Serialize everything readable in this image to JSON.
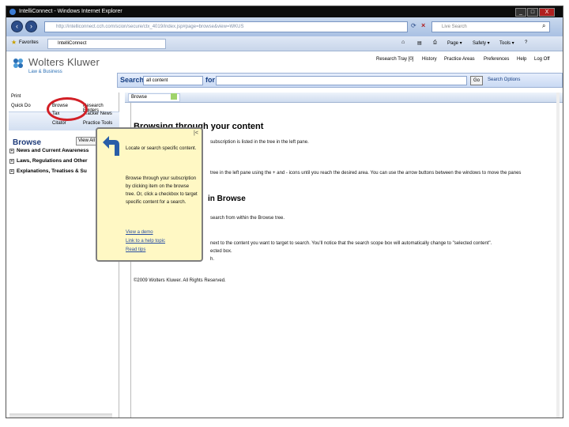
{
  "window": {
    "title": "IntelliConnect - Windows Internet Explorer",
    "controls": [
      "_",
      "□",
      "X"
    ]
  },
  "address": {
    "url": "http://intelliconnect.cch.com/scion/secure/ctx_4019/index.jsp#page=browse&view=WKUS",
    "search_placeholder": "Live Search"
  },
  "favorites": {
    "label": "Favorites",
    "tab_label": "IntelliConnect"
  },
  "command_bar": {
    "page": "Page ▾",
    "safety": "Safety ▾",
    "tools": "Tools ▾",
    "help": "?"
  },
  "brand": {
    "name": "Wolters Kluwer",
    "sub": "Law & Business"
  },
  "top_links": [
    "Research Tray [0]",
    "History",
    "Practice Areas",
    "Preferences",
    "Help",
    "Log Off"
  ],
  "search": {
    "label": "Search",
    "scope": "all content",
    "for_label": "for",
    "go": "Go",
    "options": "Search Options"
  },
  "left": {
    "print_label": "Print",
    "quick_label": "Quick Do",
    "nav": {
      "browse": "Browse",
      "research_folders": "Research Folders",
      "tax_label": "Tax",
      "tracker_news": "Tracker News",
      "citator": "Citator",
      "practice_tools": "Practice Tools"
    },
    "browse_title": "Browse",
    "view_all": "View All",
    "tree": [
      "News and Current Awareness",
      "Laws, Regulations and Other",
      "Explanations, Treatises & Su"
    ]
  },
  "right": {
    "tab": "Browse",
    "title": "Browsing through your content",
    "lines": [
      "subscription is listed in the tree in the left pane.",
      "tree in the left pane using the + and - icons until you reach the desired area. You can use the arrow buttons between the windows to move the panes"
    ],
    "subtitle": "in Browse",
    "line3": "search from within the Browse tree.",
    "line4": "next to the content you want to target to search. You'll notice that the search scope box will automatically change to \"selected content\".",
    "line5": "ected box.",
    "line6": "h.",
    "copyright": "©2009 Wolters Kluwer. All Rights Reserved."
  },
  "callout": {
    "p1": "Locate or search specific content.",
    "p2": "Browse through your subscription by clicking item on the browse tree. Or, click a checkbox to target specific content for a search.",
    "link_view": "View a demo",
    "link_help": "Link to a help topic",
    "link_read": "Read tips",
    "close": "|<"
  },
  "colors": {
    "brand_blue": "#163f84",
    "highlight_red": "#d21f26",
    "callout_bg": "#fff8c4"
  }
}
